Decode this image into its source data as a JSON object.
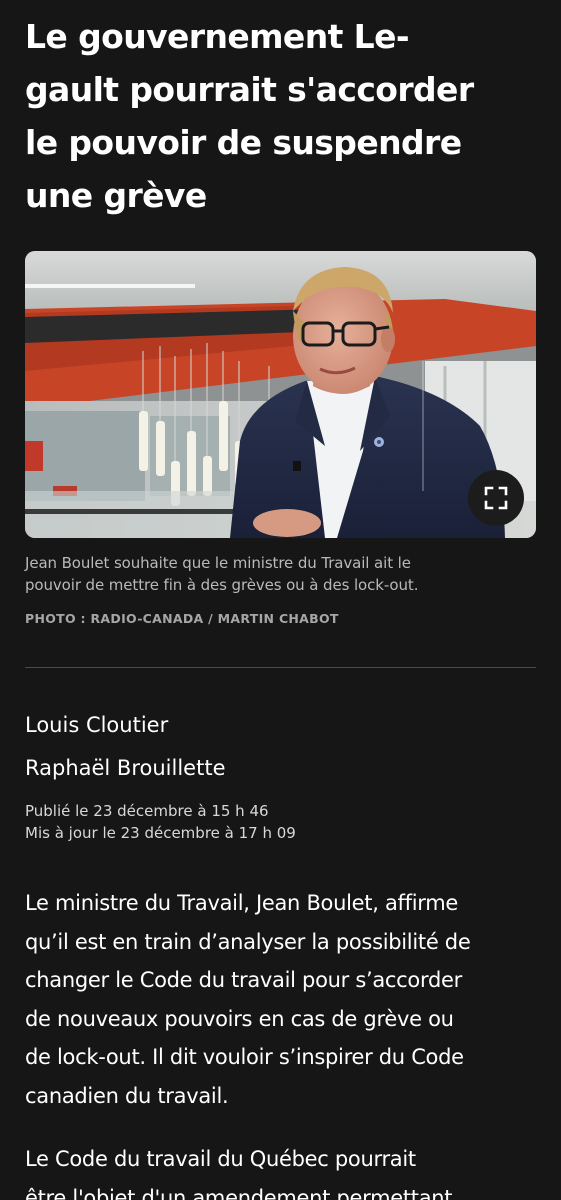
{
  "article": {
    "title_lines": [
      "Le gouvernement Le-",
      "gault pourrait s'accorder",
      "le pouvoir de suspendre",
      "une grève"
    ],
    "photo": {
      "alt": "Jean Boulet",
      "caption_lines": [
        "Jean Boulet souhaite que le ministre du Travail ait le",
        "pouvoir de mettre fin à des grèves ou à des lock-out."
      ],
      "credit": "PHOTO : RADIO-CANADA / MARTIN CHABOT",
      "fullscreen_icon": "expand-icon"
    },
    "authors": [
      "Louis Cloutier",
      "Raphaël Brouillette"
    ],
    "published": "Publié le 23 décembre à 15 h 46",
    "updated": "Mis à jour le 23 décembre à 17 h 09",
    "paragraphs": [
      {
        "lines": [
          "Le ministre du Travail, Jean Boulet, affirme",
          "qu’il est en train d’analyser la possibilité de",
          "changer le Code du travail pour s’accorder",
          "de nouveaux pouvoirs en cas de grève ou",
          "de lock-out. Il dit vouloir s’inspirer du Code",
          "canadien du travail."
        ]
      },
      {
        "lines": [
          "Le Code du travail du Québec pourrait",
          "être l'objet d'un amendement permettant"
        ]
      }
    ]
  },
  "colors": {
    "background": "#161616",
    "text": "#ffffff",
    "caption": "#b9b9b9",
    "credit": "#a6a6a6",
    "divider": "#4a4a4a",
    "fullscreen_button": "#1c1c1c"
  }
}
